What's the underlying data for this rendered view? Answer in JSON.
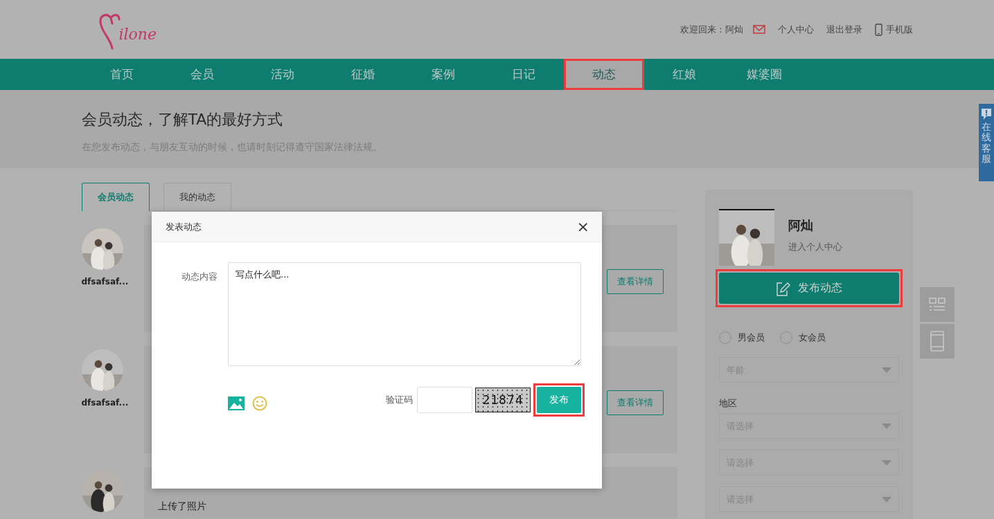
{
  "header": {
    "logo": "ilone",
    "welcome": "欢迎回来：阿灿",
    "links": [
      {
        "label": "个人中心"
      },
      {
        "label": "退出登录"
      },
      {
        "label": "手机版"
      }
    ]
  },
  "nav": [
    {
      "label": "首页",
      "selected": false
    },
    {
      "label": "会员",
      "selected": false
    },
    {
      "label": "活动",
      "selected": false
    },
    {
      "label": "征婚",
      "selected": false
    },
    {
      "label": "案例",
      "selected": false
    },
    {
      "label": "日记",
      "selected": false
    },
    {
      "label": "动态",
      "selected": true,
      "highlighted": true
    },
    {
      "label": "红娘",
      "selected": false
    },
    {
      "label": "媒婆圈",
      "selected": false
    }
  ],
  "banner": {
    "title": "会员动态，了解TA的最好方式",
    "subtitle": "在您发布动态，与朋友互动的时候，也请时刻记得遵守国家法律法规。"
  },
  "tabs": [
    {
      "label": "会员动态",
      "selected": true
    },
    {
      "label": "我的动态",
      "selected": false
    }
  ],
  "feed": [
    {
      "user": "dfsafsaf...",
      "button": "查看详情"
    },
    {
      "user": "dfsafsaf...",
      "button": "查看详情"
    },
    {
      "text": "上传了照片"
    }
  ],
  "profile": {
    "name": "阿灿",
    "link": "进入个人中心",
    "publish": {
      "label": "发布动态",
      "highlighted": true
    }
  },
  "filters": {
    "genders": [
      {
        "label": "男会员",
        "selected": false
      },
      {
        "label": "女会员",
        "selected": false
      }
    ],
    "age": {
      "placeholder": "年龄"
    },
    "region_label": "地区",
    "regions": [
      {
        "placeholder": "请选择"
      },
      {
        "placeholder": "请选择"
      },
      {
        "placeholder": "请选择"
      }
    ]
  },
  "service_tab": "在线客服",
  "modal": {
    "title": "发表动态",
    "close": "×",
    "content_label": "动态内容",
    "content_value": "写点什么吧...",
    "captcha_label": "验证码",
    "captcha_code": "21874",
    "submit": {
      "label": "发布",
      "highlighted": true
    }
  }
}
